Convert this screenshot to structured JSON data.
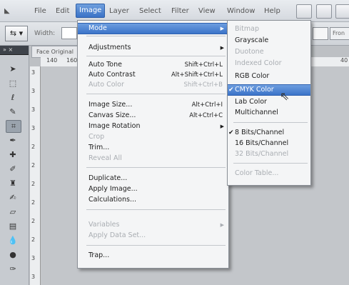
{
  "menubar": {
    "items": [
      "File",
      "Edit",
      "Image",
      "Layer",
      "Select",
      "Filter",
      "View",
      "Window",
      "Help"
    ]
  },
  "options": {
    "preset_glyph": "⇆ ▾",
    "label": "Width:",
    "right_label": "Fron"
  },
  "document": {
    "tab": "Face Original",
    "ruler_top": [
      "140",
      "160",
      "40"
    ],
    "ruler_left": [
      "3",
      "3",
      "3",
      "3",
      "2",
      "2",
      "2",
      "2",
      "2",
      "2",
      "3",
      "3"
    ]
  },
  "image_menu": {
    "items": [
      {
        "label": "Mode",
        "shortcut": "",
        "submenu": true,
        "disabled": false,
        "highlighted": true
      },
      {
        "label": "Adjustments",
        "shortcut": "",
        "submenu": true,
        "disabled": false
      },
      {
        "label": "Auto Tone",
        "shortcut": "Shift+Ctrl+L",
        "disabled": false
      },
      {
        "label": "Auto Contrast",
        "shortcut": "Alt+Shift+Ctrl+L",
        "disabled": false
      },
      {
        "label": "Auto Color",
        "shortcut": "Shift+Ctrl+B",
        "disabled": true
      },
      {
        "label": "Image Size...",
        "shortcut": "Alt+Ctrl+I",
        "disabled": false
      },
      {
        "label": "Canvas Size...",
        "shortcut": "Alt+Ctrl+C",
        "disabled": false
      },
      {
        "label": "Image Rotation",
        "shortcut": "",
        "submenu": true,
        "disabled": false
      },
      {
        "label": "Crop",
        "shortcut": "",
        "disabled": true
      },
      {
        "label": "Trim...",
        "shortcut": "",
        "disabled": false
      },
      {
        "label": "Reveal All",
        "shortcut": "",
        "disabled": true
      },
      {
        "label": "Duplicate...",
        "shortcut": "",
        "disabled": false
      },
      {
        "label": "Apply Image...",
        "shortcut": "",
        "disabled": false
      },
      {
        "label": "Calculations...",
        "shortcut": "",
        "disabled": false
      },
      {
        "label": "Variables",
        "shortcut": "",
        "submenu": true,
        "disabled": true
      },
      {
        "label": "Apply Data Set...",
        "shortcut": "",
        "disabled": true
      },
      {
        "label": "Trap...",
        "shortcut": "",
        "disabled": false
      }
    ]
  },
  "mode_menu": {
    "items": [
      {
        "label": "Bitmap",
        "disabled": true
      },
      {
        "label": "Grayscale",
        "disabled": false
      },
      {
        "label": "Duotone",
        "disabled": true
      },
      {
        "label": "Indexed Color",
        "disabled": true
      },
      {
        "label": "RGB Color",
        "disabled": false
      },
      {
        "label": "CMYK Color",
        "disabled": false,
        "checked": true,
        "highlighted": true
      },
      {
        "label": "Lab Color",
        "disabled": false
      },
      {
        "label": "Multichannel",
        "disabled": false
      },
      {
        "label": "8 Bits/Channel",
        "disabled": false,
        "checked": true
      },
      {
        "label": "16 Bits/Channel",
        "disabled": false
      },
      {
        "label": "32 Bits/Channel",
        "disabled": true
      },
      {
        "label": "Color Table...",
        "disabled": true
      }
    ]
  },
  "colors": {
    "highlight": "#3b73c9",
    "menu_bg": "#f4f5f6",
    "disabled": "#a9adb2"
  }
}
